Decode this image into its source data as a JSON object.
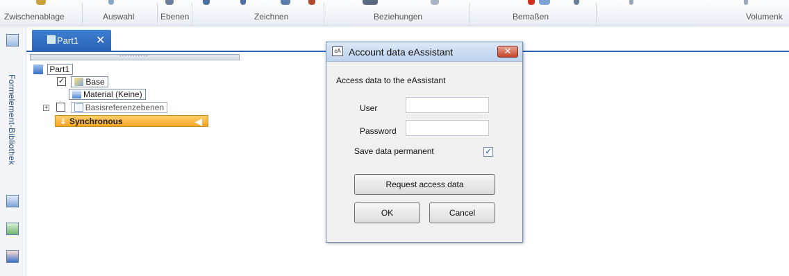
{
  "ribbon": {
    "groups": [
      {
        "id": "zwischenablage",
        "label": "Zwischenablage"
      },
      {
        "id": "auswahl",
        "label": "Auswahl"
      },
      {
        "id": "ebenen",
        "label": "Ebenen"
      },
      {
        "id": "zeichnen",
        "label": "Zeichnen"
      },
      {
        "id": "beziehungen",
        "label": "Beziehungen"
      },
      {
        "id": "bemassen",
        "label": "Bemaßen"
      },
      {
        "id": "volumen",
        "label": "Volumenk"
      }
    ]
  },
  "leftbar": {
    "library_label": "Formelement-Bibliothek"
  },
  "document_tab": {
    "title": "Part1",
    "close_glyph": "✕"
  },
  "tree": {
    "root_label": "Part1",
    "base_label": "Base",
    "material_label": "Material (Keine)",
    "basisref_label": "Basisreferenzebenen",
    "sync_label": "Synchronous",
    "base_checked": true,
    "basisref_checked": false
  },
  "dialog": {
    "title": "Account data eAssistant",
    "title_icon": "cA",
    "close_glyph": "✕",
    "heading": "Access data to the eAssistant",
    "user_label": "User",
    "user_value": "",
    "password_label": "Password",
    "password_value": "",
    "save_label": "Save data permanent",
    "save_checked": true,
    "request_button": "Request access data",
    "ok_button": "OK",
    "cancel_button": "Cancel"
  },
  "colors": {
    "tab_blue": "#2a63b6",
    "sync_orange": "#f5a623",
    "dialog_bg": "#f0f0f0",
    "close_red": "#c5442a"
  }
}
